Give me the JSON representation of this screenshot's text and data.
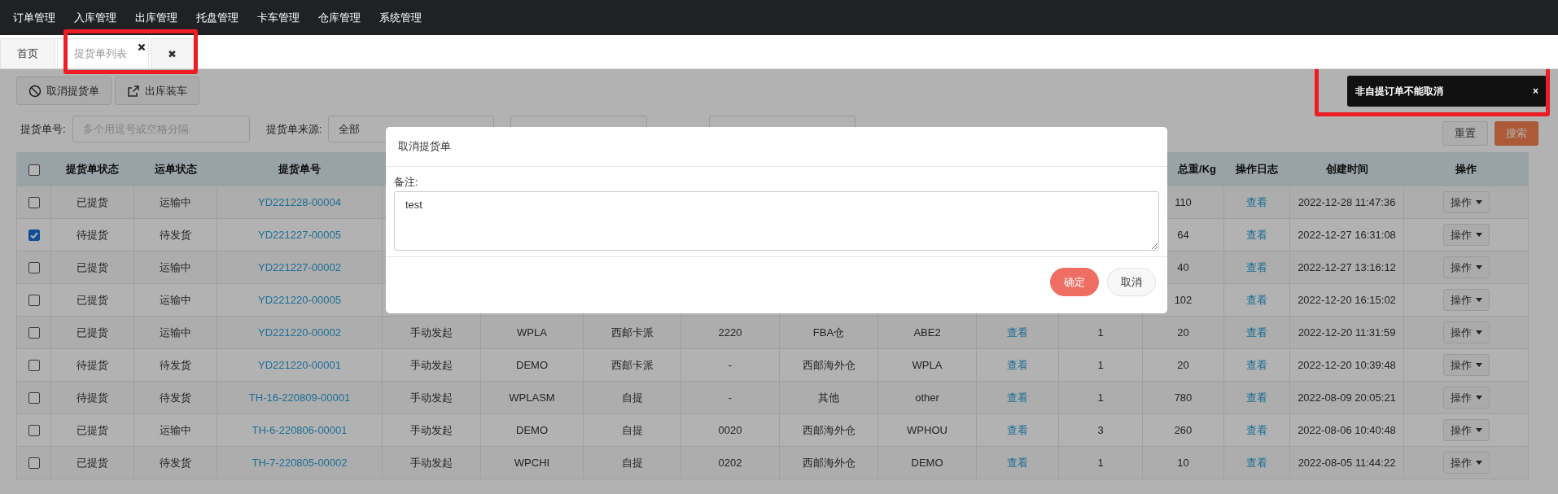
{
  "nav": {
    "items": [
      "订单管理",
      "入库管理",
      "出库管理",
      "托盘管理",
      "卡车管理",
      "仓库管理",
      "系统管理"
    ]
  },
  "tab_bar": {
    "highlighted": true,
    "tabs": [
      {
        "label": "首页",
        "selected": false,
        "closable": false
      },
      {
        "label": "提货单列表",
        "selected": true,
        "closable": true
      }
    ],
    "close_all": "✖"
  },
  "toolbar": {
    "buttons": [
      {
        "label": "取消提货单",
        "kind": "ban"
      },
      {
        "label": "出库装车",
        "kind": "export"
      }
    ]
  },
  "filters": {
    "number_label": "提货单号:",
    "number_placeholder": "多个用逗号或空格分隔",
    "source_label": "提货单来源:",
    "source_value": "全部",
    "reset": "重置",
    "search": "搜索"
  },
  "table": {
    "header": {
      "select_all": {
        "checked": false
      },
      "column_1": "提货单状态",
      "column_2": "运单状态",
      "column_3": "提货单号",
      "column_12": "总重/Kg",
      "column_13": "操作日志",
      "column_14": "创建时间",
      "column_15": "操作"
    },
    "rows": [
      {
        "checked": false,
        "column_1": "已提货",
        "column_2": "运输中",
        "column_3": "YD221228-00004",
        "column_12": "110",
        "column_13": "查看",
        "column_14": "2022-12-28 11:47:36",
        "column_15": "操作"
      },
      {
        "checked": true,
        "column_1": "待提货",
        "column_2": "待发货",
        "column_3": "YD221227-00005",
        "column_12": "64",
        "column_13": "查看",
        "column_14": "2022-12-27 16:31:08",
        "column_15": "操作"
      },
      {
        "checked": false,
        "column_1": "已提货",
        "column_2": "运输中",
        "column_3": "YD221227-00002",
        "column_12": "40",
        "column_13": "查看",
        "column_14": "2022-12-27 13:16:12",
        "column_15": "操作"
      },
      {
        "checked": false,
        "column_1": "已提货",
        "column_2": "运输中",
        "column_3": "YD221220-00005",
        "column_12": "102",
        "column_13": "查看",
        "column_14": "2022-12-20 16:15:02",
        "column_15": "操作"
      },
      {
        "checked": false,
        "column_1": "已提货",
        "column_2": "运输中",
        "column_3": "YD221220-00002",
        "column_4": "手动发起",
        "column_5": "WPLA",
        "column_6": "西邮卡派",
        "column_7": "2220",
        "column_8": "FBA仓",
        "column_9": "ABE2",
        "column_10": "查看",
        "column_11": "1",
        "column_12": "20",
        "column_13": "查看",
        "column_14": "2022-12-20 11:31:59",
        "column_15": "操作"
      },
      {
        "checked": false,
        "column_1": "待提货",
        "column_2": "待发货",
        "column_3": "YD221220-00001",
        "column_4": "手动发起",
        "column_5": "DEMO",
        "column_6": "西邮卡派",
        "column_7": "-",
        "column_8": "西邮海外仓",
        "column_9": "WPLA",
        "column_10": "查看",
        "column_11": "1",
        "column_12": "20",
        "column_13": "查看",
        "column_14": "2022-12-20 10:39:48",
        "column_15": "操作"
      },
      {
        "checked": false,
        "column_1": "待提货",
        "column_2": "待发货",
        "column_3": "TH-16-220809-00001",
        "column_4": "手动发起",
        "column_5": "WPLASM",
        "column_6": "自提",
        "column_7": "-",
        "column_8": "其他",
        "column_9": "other",
        "column_10": "查看",
        "column_11": "1",
        "column_12": "780",
        "column_13": "查看",
        "column_14": "2022-08-09 20:05:21",
        "column_15": "操作"
      },
      {
        "checked": false,
        "column_1": "已提货",
        "column_2": "运输中",
        "column_3": "TH-6-220806-00001",
        "column_4": "手动发起",
        "column_5": "DEMO",
        "column_6": "自提",
        "column_7": "0020",
        "column_8": "西邮海外仓",
        "column_9": "WPHOU",
        "column_10": "查看",
        "column_11": "3",
        "column_12": "260",
        "column_13": "查看",
        "column_14": "2022-08-06 10:40:48",
        "column_15": "操作"
      },
      {
        "checked": false,
        "column_1": "已提货",
        "column_2": "待发货",
        "column_3": "TH-7-220805-00002",
        "column_4": "手动发起",
        "column_5": "WPCHI",
        "column_6": "自提",
        "column_7": "0202",
        "column_8": "西邮海外仓",
        "column_9": "DEMO",
        "column_10": "查看",
        "column_11": "1",
        "column_12": "10",
        "column_13": "查看",
        "column_14": "2022-08-05 11:44:22",
        "column_15": "操作"
      }
    ]
  },
  "dialog": {
    "title": "取消提货单",
    "label": "备注:",
    "value": "test",
    "buttons": [
      {
        "label": "确定",
        "kind": "primary"
      },
      {
        "label": "取消",
        "kind": "default"
      }
    ]
  },
  "toast": {
    "highlighted": true,
    "message": "非自提订单不能取消",
    "close": "×"
  }
}
